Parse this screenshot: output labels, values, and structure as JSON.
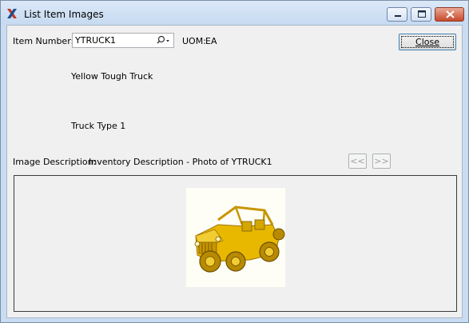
{
  "window": {
    "title": "List Item Images"
  },
  "form": {
    "item_number_label": "Item Number:",
    "item_number_value": "YTRUCK1",
    "uom_label": "UOM:",
    "uom_value": "EA",
    "description_line1": "Yellow Tough Truck",
    "description_line2": "Truck Type 1",
    "image_description_label": "Image Description:",
    "image_description_value": "Inventory Description - Photo of YTRUCK1"
  },
  "buttons": {
    "close_label": "Close",
    "prev_label": "<<",
    "next_label": ">>"
  },
  "icons": {
    "app": "x-logo-icon",
    "lookup": "magnifier-dropdown-icon",
    "photo": "truck-photo"
  },
  "colors": {
    "titlebar": "#c6daf1",
    "client_bg": "#f0f0f0",
    "close_window_button": "#c74a2d",
    "truck": "#e8b800"
  }
}
